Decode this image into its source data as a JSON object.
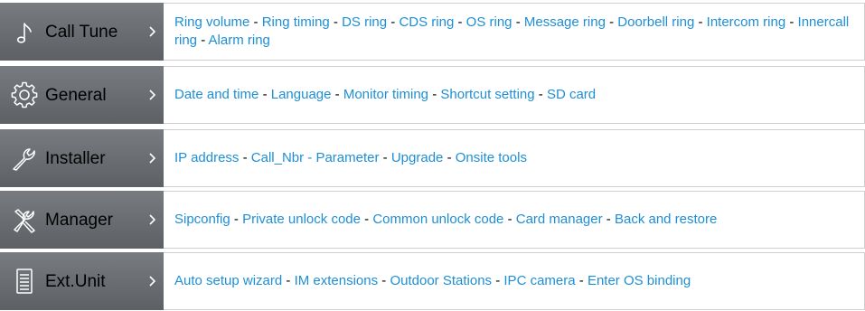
{
  "colors": {
    "link": "#1d8fd6",
    "separator": "#000000",
    "category_bg": "#6b6e73",
    "row_border": "#cfcfcf"
  },
  "rows": [
    {
      "label": "Call Tune",
      "icon": "music-note-icon",
      "links": [
        "Ring volume",
        "Ring timing",
        "DS ring",
        "CDS ring",
        "OS ring",
        "Message ring",
        "Doorbell ring",
        "Intercom ring",
        "Innercall ring",
        "Alarm ring"
      ]
    },
    {
      "label": "General",
      "icon": "gear-icon",
      "links": [
        "Date and time",
        "Language",
        "Monitor timing",
        "Shortcut setting",
        "SD card"
      ]
    },
    {
      "label": "Installer",
      "icon": "wrench-icon",
      "links": [
        "IP address",
        "Call_Nbr - Parameter",
        "Upgrade",
        "Onsite tools"
      ]
    },
    {
      "label": "Manager",
      "icon": "tools-icon",
      "links": [
        "Sipconfig",
        "Private unlock code",
        "Common unlock code",
        "Card manager",
        "Back and restore"
      ]
    },
    {
      "label": "Ext.Unit",
      "icon": "list-document-icon",
      "links": [
        "Auto setup wizard",
        "IM extensions",
        "Outdoor Stations",
        "IPC camera",
        "Enter OS binding"
      ]
    }
  ],
  "separator": "-"
}
